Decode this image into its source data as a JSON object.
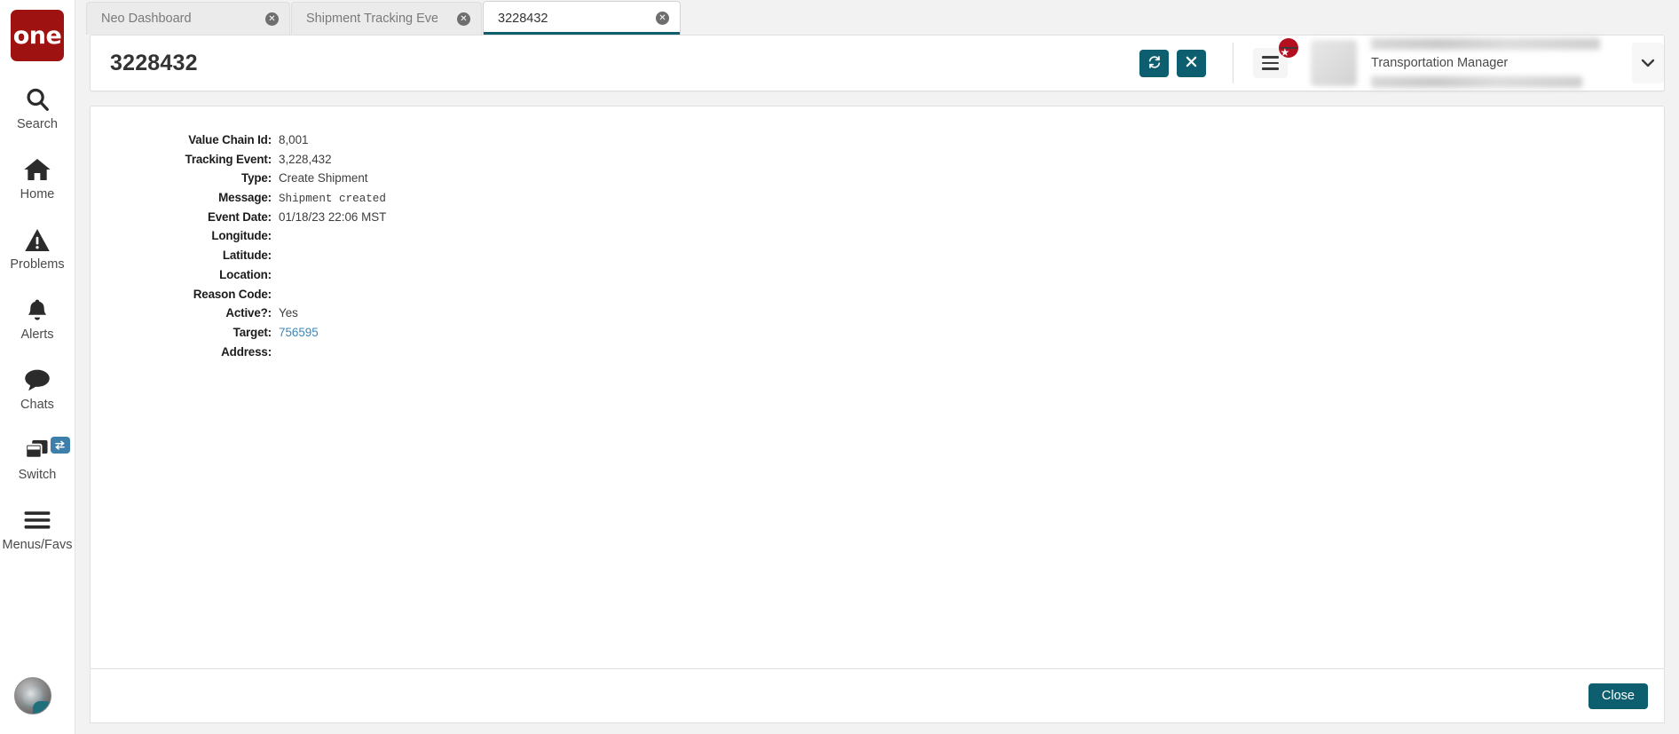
{
  "sidebar": {
    "logo_text": "one",
    "items": [
      {
        "label": "Search",
        "icon": "search-icon"
      },
      {
        "label": "Home",
        "icon": "home-icon"
      },
      {
        "label": "Problems",
        "icon": "warning-triangle-icon"
      },
      {
        "label": "Alerts",
        "icon": "bell-icon"
      },
      {
        "label": "Chats",
        "icon": "chat-bubble-icon"
      },
      {
        "label": "Switch",
        "icon": "switch-windows-icon"
      },
      {
        "label": "Menus/Favs",
        "icon": "hamburger-menu-icon"
      }
    ]
  },
  "tabs": [
    {
      "label": "Neo Dashboard",
      "active": false
    },
    {
      "label": "Shipment Tracking Event Report",
      "active": false
    },
    {
      "label": "3228432",
      "active": true
    }
  ],
  "header": {
    "title": "3228432",
    "refresh_icon": "refresh-icon",
    "close_icon": "close-x-icon",
    "menu_icon": "hamburger-menu-icon",
    "star_badge_icon": "star-icon",
    "user_role": "Transportation Manager",
    "user_caret_icon": "chevron-down-icon"
  },
  "details": {
    "fields": [
      {
        "label": "Value Chain Id:",
        "value": "8,001",
        "style": "plain"
      },
      {
        "label": "Tracking Event:",
        "value": "3,228,432",
        "style": "plain"
      },
      {
        "label": "Type:",
        "value": "Create Shipment",
        "style": "plain"
      },
      {
        "label": "Message:",
        "value": "Shipment created",
        "style": "mono"
      },
      {
        "label": "Event Date:",
        "value": "01/18/23 22:06 MST",
        "style": "plain"
      },
      {
        "label": "Longitude:",
        "value": "",
        "style": "plain"
      },
      {
        "label": "Latitude:",
        "value": "",
        "style": "plain"
      },
      {
        "label": "Location:",
        "value": "",
        "style": "plain"
      },
      {
        "label": "Reason Code:",
        "value": "",
        "style": "plain"
      },
      {
        "label": "Active?:",
        "value": "Yes",
        "style": "plain"
      },
      {
        "label": "Target:",
        "value": "756595",
        "style": "link"
      },
      {
        "label": "Address:",
        "value": "",
        "style": "plain"
      }
    ]
  },
  "footer": {
    "close_label": "Close"
  },
  "colors": {
    "accent_teal": "#0d5f6f",
    "brand_red": "#9e1212",
    "badge_red": "#b30f1f",
    "link_blue": "#3c87b8"
  }
}
